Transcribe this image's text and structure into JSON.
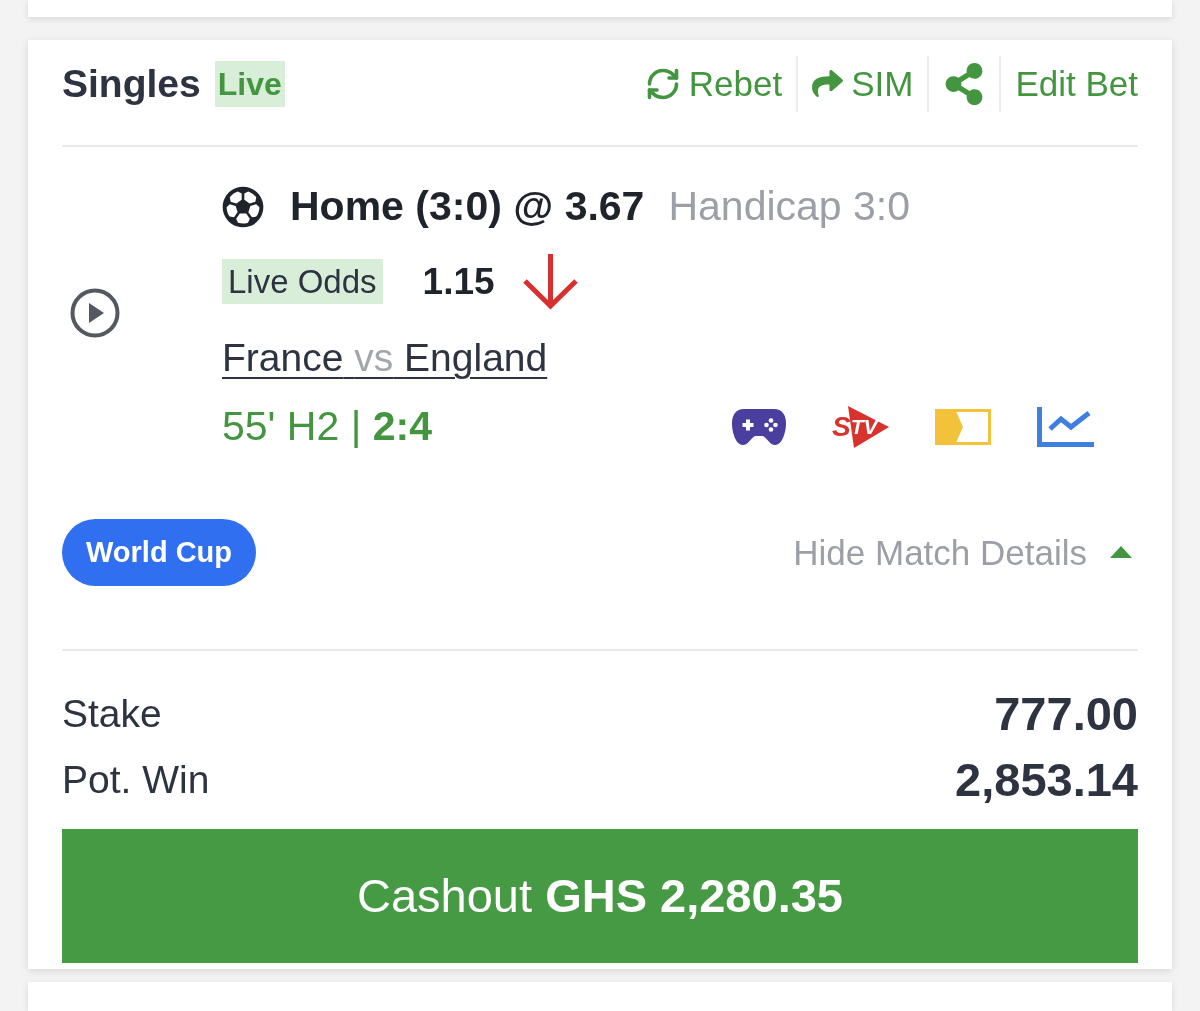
{
  "header": {
    "title": "Singles",
    "badge": "Live",
    "actions": [
      {
        "kind": "rebet",
        "label": "Rebet"
      },
      {
        "kind": "sim",
        "label": "SIM"
      },
      {
        "kind": "share"
      },
      {
        "kind": "edit",
        "label": "Edit Bet"
      }
    ]
  },
  "selection": {
    "pick": "Home (3:0) @ 3.67",
    "market": "Handicap 3:0",
    "live_odds": {
      "label": "Live Odds",
      "value": "1.15",
      "falling": true
    },
    "match": {
      "home": "France",
      "separator": "vs",
      "away": "England"
    },
    "status": "55' H2 | **2:4**",
    "features": [
      {
        "kind": "game"
      },
      {
        "kind": "tv",
        "letter": "S",
        "text": "TV"
      },
      {
        "kind": "ticket"
      },
      {
        "kind": "stats"
      }
    ]
  },
  "competition": "World Cup",
  "details_toggle": {
    "label": "Hide Match Details",
    "expanded": true
  },
  "summary": [
    {
      "label": "Stake",
      "value": "777.00"
    },
    {
      "label": "Pot. Win",
      "value": "2,853.14"
    }
  ],
  "cashout": {
    "label": "Cashout **GHS 2,280.35**"
  }
}
